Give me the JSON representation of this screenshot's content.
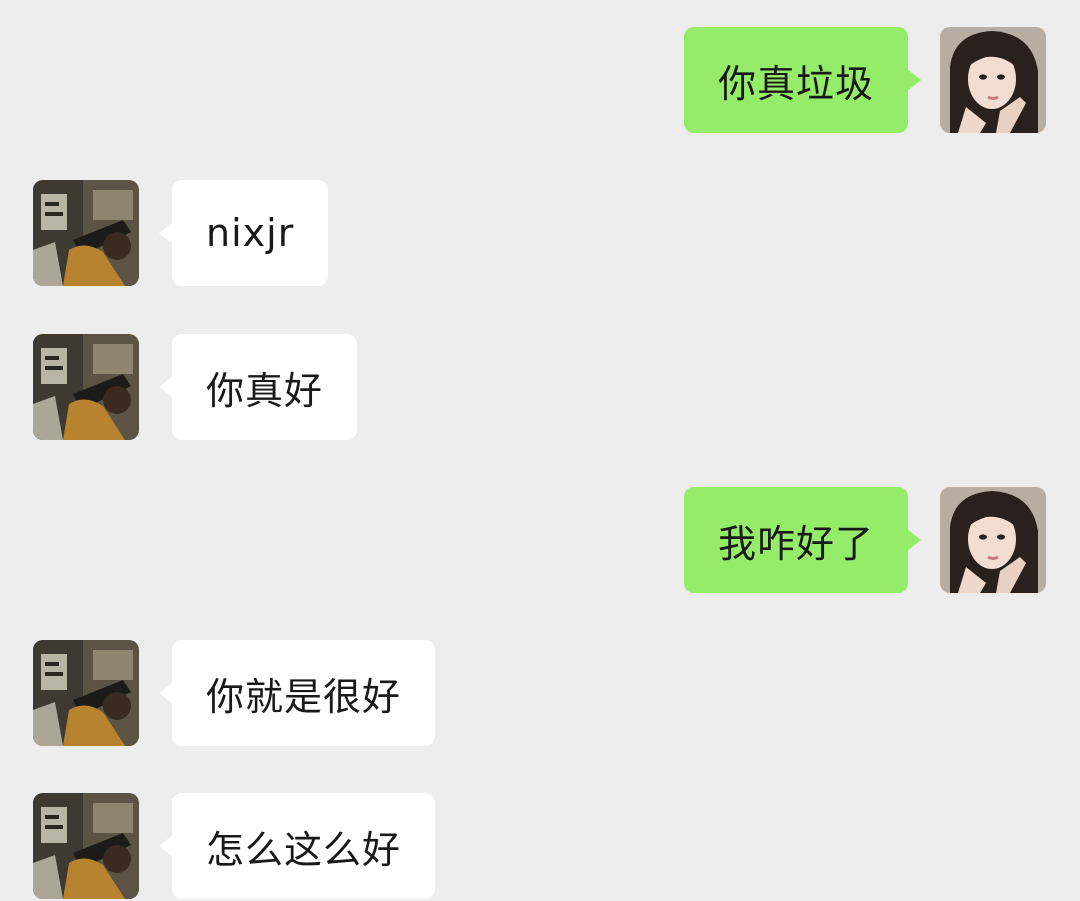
{
  "messages": [
    {
      "side": "right",
      "sender": "self",
      "text": "你真垃圾"
    },
    {
      "side": "left",
      "sender": "other",
      "text": "nixjr"
    },
    {
      "side": "left",
      "sender": "other",
      "text": "你真好"
    },
    {
      "side": "right",
      "sender": "self",
      "text": "我咋好了"
    },
    {
      "side": "left",
      "sender": "other",
      "text": "你就是很好"
    },
    {
      "side": "left",
      "sender": "other",
      "text": "怎么这么好"
    }
  ],
  "colors": {
    "background": "#ededed",
    "self_bubble": "#95ec69",
    "other_bubble": "#ffffff",
    "text": "#191919"
  },
  "icons": {
    "self_avatar": "avatar-self-photo",
    "other_avatar": "avatar-other-photo"
  }
}
